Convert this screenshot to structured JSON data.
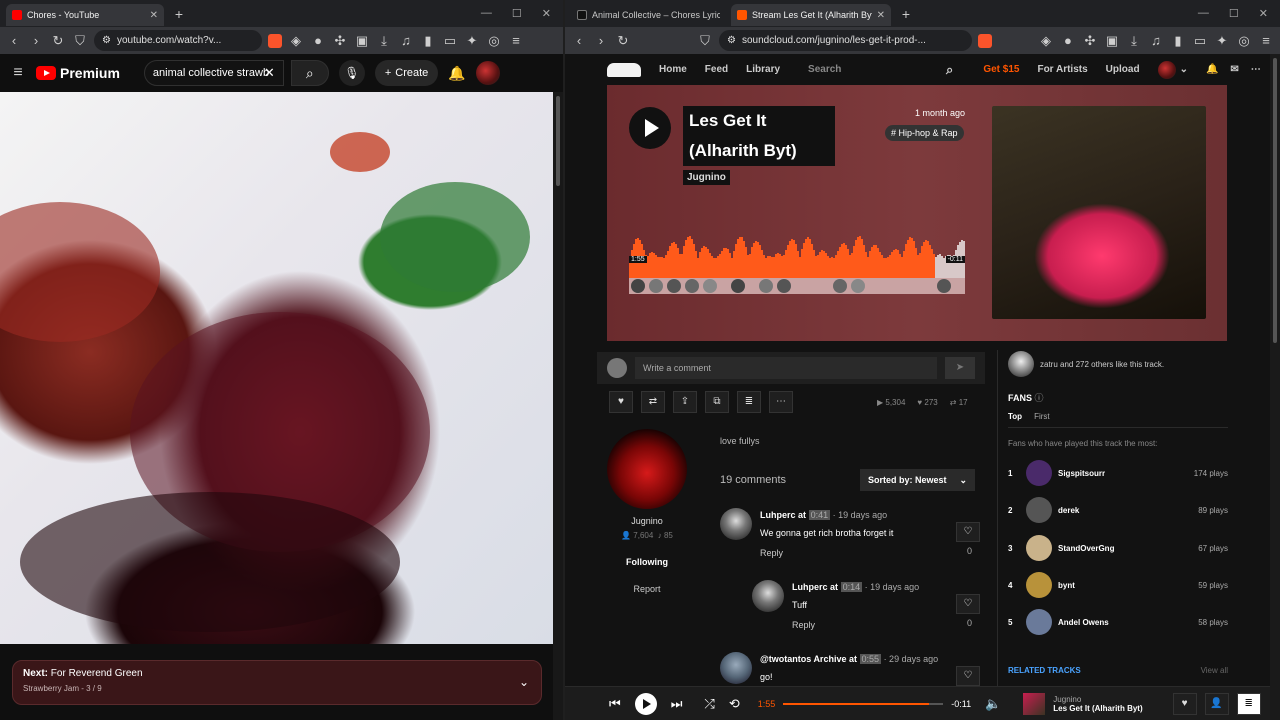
{
  "left": {
    "tab_title": "Chores - YouTube",
    "url": "youtube.com/watch?v...",
    "yt_logo": "Premium",
    "search_value": "animal collective strawb",
    "create_label": "Create",
    "next_label": "Next:",
    "next_title": "For Reverend Green",
    "next_sub": "Strawberry Jam - 3 / 9"
  },
  "right": {
    "tab1_title": "Animal Collective – Chores Lyrics | Ge",
    "tab2_title": "Stream Les Get It (Alharith Byt) b",
    "url": "soundcloud.com/jugnino/les-get-it-prod-...",
    "nav": {
      "home": "Home",
      "feed": "Feed",
      "library": "Library",
      "search": "Search",
      "get": "Get $15",
      "artists": "For Artists",
      "upload": "Upload"
    },
    "hero": {
      "title": "Les Get It (Alharith Byt)",
      "artist": "Jugnino",
      "date": "1 month ago",
      "tag": "# Hip-hop & Rap",
      "time_start": "1:55",
      "time_end": "-0:11"
    },
    "comment_placeholder": "Write a comment",
    "stats": {
      "plays": "5,304",
      "likes": "273",
      "reposts": "17"
    },
    "artist": {
      "name": "Jugnino",
      "followers": "7,604",
      "tracks": "85",
      "follow": "Following",
      "report": "Report"
    },
    "description": "love fullys",
    "comments_count": "19 comments",
    "sort_label": "Sorted by: Newest",
    "comments": [
      {
        "user": "Luhperc",
        "at": "at",
        "ts": "0:41",
        "ago": "· 19 days ago",
        "text": "We gonna get rich brotha forget it",
        "reply": "Reply",
        "likes": "0"
      },
      {
        "user": "Luhperc",
        "at": "at",
        "ts": "0:14",
        "ago": "· 19 days ago",
        "text": "Tuff",
        "reply": "Reply",
        "likes": "0"
      },
      {
        "user": "@twotantos Archive",
        "at": "at",
        "ts": "0:55",
        "ago": "· 29 days ago",
        "text": "go!",
        "reply": "",
        "likes": ""
      }
    ],
    "likes_text": "zatru and 272 others like this track.",
    "fans_title": "FANS",
    "fans_tab_top": "Top",
    "fans_tab_first": "First",
    "fans_note": "Fans who have played this track the most:",
    "fans": [
      {
        "rank": "1",
        "name": "Sigspitsourr",
        "plays": "174 plays",
        "color": "#4a2a6a"
      },
      {
        "rank": "2",
        "name": "derek",
        "plays": "89 plays",
        "color": "#555555"
      },
      {
        "rank": "3",
        "name": "StandOverGng",
        "plays": "67 plays",
        "color": "#c9b28a"
      },
      {
        "rank": "4",
        "name": "bynt",
        "plays": "59 plays",
        "color": "#b8923a"
      },
      {
        "rank": "5",
        "name": "Andel Owens",
        "plays": "58 plays",
        "color": "#6a7a9a"
      }
    ],
    "related_title": "RELATED TRACKS",
    "view_all": "View all",
    "player": {
      "time_now": "1:55",
      "time_left": "-0:11",
      "progress": 0.91,
      "artist": "Jugnino",
      "title": "Les Get It (Alharith Byt)"
    }
  }
}
